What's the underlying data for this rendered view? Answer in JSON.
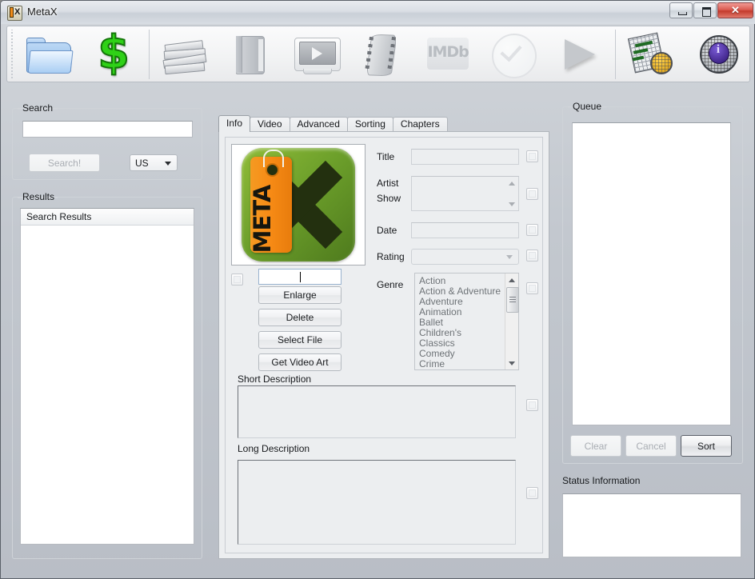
{
  "window": {
    "title": "MetaX",
    "app_icon": "metax-app-icon",
    "buttons": {
      "minimize": "minimize",
      "maximize": "maximize",
      "close": "✕"
    }
  },
  "toolbar": {
    "items": [
      {
        "name": "open-folder",
        "icon": "folder-icon"
      },
      {
        "name": "purchase",
        "icon": "dollar-icon"
      },
      {
        "name": "library",
        "icon": "books-stack-icon"
      },
      {
        "name": "book",
        "icon": "book-icon"
      },
      {
        "name": "video-player",
        "icon": "monitor-play-icon"
      },
      {
        "name": "film",
        "icon": "film-strip-icon"
      },
      {
        "name": "imdb",
        "icon": "imdb-icon",
        "label": "IMDb"
      },
      {
        "name": "apply-check",
        "icon": "check-circle-icon"
      },
      {
        "name": "run",
        "icon": "play-arrow-icon"
      },
      {
        "name": "subtitles",
        "icon": "subtitle-tags-icon"
      },
      {
        "name": "info-globe",
        "icon": "info-globe-icon"
      }
    ]
  },
  "search_panel": {
    "title": "Search",
    "input_value": "",
    "input_placeholder": "",
    "search_button": "Search!",
    "region_select": {
      "value": "US",
      "options": [
        "US"
      ]
    }
  },
  "results_panel": {
    "title": "Results",
    "column_header": "Search Results",
    "rows": []
  },
  "tabs": [
    {
      "label": "Info",
      "active": true
    },
    {
      "label": "Video",
      "active": false
    },
    {
      "label": "Advanced",
      "active": false
    },
    {
      "label": "Sorting",
      "active": false
    },
    {
      "label": "Chapters",
      "active": false
    }
  ],
  "info_tab": {
    "artwork": {
      "alt": "MetaX logo artwork",
      "tag_text": "META",
      "x_letter": "X"
    },
    "artwork_filename_value": "",
    "artwork_buttons": [
      "Enlarge",
      "Delete",
      "Select File",
      "Get Video Art"
    ],
    "fields": {
      "title": {
        "label": "Title",
        "value": ""
      },
      "artist": {
        "label": "Artist",
        "value": ""
      },
      "show": {
        "label": "Show",
        "value": ""
      },
      "date": {
        "label": "Date",
        "value": ""
      },
      "rating": {
        "label": "Rating",
        "value": "",
        "options": []
      },
      "genre": {
        "label": "Genre",
        "options": [
          "Action",
          "Action & Adventure",
          "Adventure",
          "Animation",
          "Ballet",
          "Children's",
          "Classics",
          "Comedy",
          "Crime"
        ],
        "selected": ""
      }
    },
    "short_description": {
      "label": "Short Description",
      "value": ""
    },
    "long_description": {
      "label": "Long Description",
      "value": ""
    }
  },
  "queue_panel": {
    "title": "Queue",
    "items": [],
    "buttons": {
      "clear": {
        "label": "Clear",
        "enabled": false
      },
      "cancel": {
        "label": "Cancel",
        "enabled": false
      },
      "sort": {
        "label": "Sort",
        "enabled": true
      }
    }
  },
  "status_panel": {
    "title": "Status Information",
    "text": ""
  },
  "colors": {
    "window_bg": "#cdd1d7",
    "panel_bg": "#eceef0",
    "accent_green": "#2fd117",
    "close_red": "#c33a2c",
    "art_green": "#6da02b",
    "art_orange": "#f68a15"
  }
}
